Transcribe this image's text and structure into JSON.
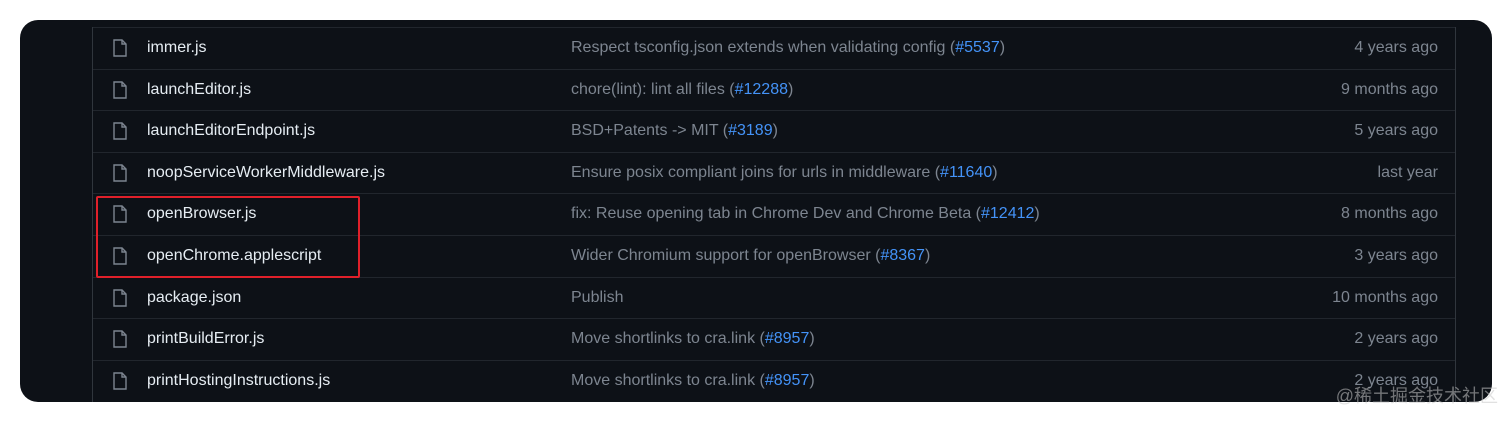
{
  "files": [
    {
      "name": "immer.js",
      "message": "Respect tsconfig.json extends when validating config (",
      "pr": "#5537",
      "message_end": ")",
      "age": "4 years ago"
    },
    {
      "name": "launchEditor.js",
      "message": "chore(lint): lint all files (",
      "pr": "#12288",
      "message_end": ")",
      "age": "9 months ago"
    },
    {
      "name": "launchEditorEndpoint.js",
      "message": "BSD+Patents -> MIT (",
      "pr": "#3189",
      "message_end": ")",
      "age": "5 years ago"
    },
    {
      "name": "noopServiceWorkerMiddleware.js",
      "message": "Ensure posix compliant joins for urls in middleware (",
      "pr": "#11640",
      "message_end": ")",
      "age": "last year"
    },
    {
      "name": "openBrowser.js",
      "message": "fix: Reuse opening tab in Chrome Dev and Chrome Beta (",
      "pr": "#12412",
      "message_end": ")",
      "age": "8 months ago"
    },
    {
      "name": "openChrome.applescript",
      "message": "Wider Chromium support for openBrowser (",
      "pr": "#8367",
      "message_end": ")",
      "age": "3 years ago"
    },
    {
      "name": "package.json",
      "message": "Publish",
      "pr": "",
      "message_end": "",
      "age": "10 months ago"
    },
    {
      "name": "printBuildError.js",
      "message": "Move shortlinks to cra.link (",
      "pr": "#8957",
      "message_end": ")",
      "age": "2 years ago"
    },
    {
      "name": "printHostingInstructions.js",
      "message": "Move shortlinks to cra.link (",
      "pr": "#8957",
      "message_end": ")",
      "age": "2 years ago"
    }
  ],
  "icons": {
    "file": "file-icon"
  },
  "colors": {
    "background": "#0d1117",
    "link": "#4493f8",
    "highlight": "#e0202a"
  },
  "watermark": "@稀土掘金技术社区"
}
